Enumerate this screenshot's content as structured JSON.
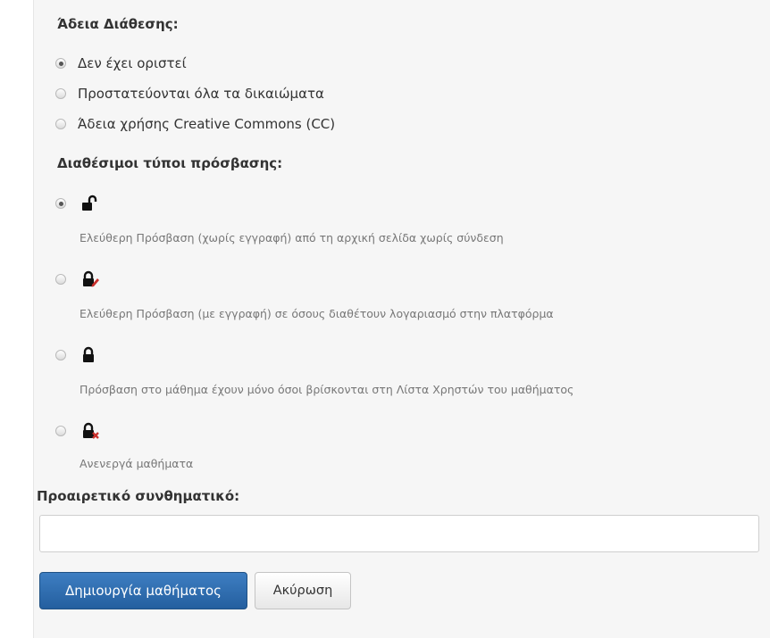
{
  "license": {
    "title": "Άδεια Διάθεσης:",
    "options": [
      {
        "label": "Δεν έχει οριστεί",
        "checked": true
      },
      {
        "label": "Προστατεύονται όλα τα δικαιώματα",
        "checked": false
      },
      {
        "label": "Άδεια χρήσης Creative Commons (CC)",
        "checked": false
      }
    ]
  },
  "access": {
    "title": "Διαθέσιμοι τύποι πρόσβασης:",
    "options": [
      {
        "icon": "unlocked-icon",
        "description": "Ελεύθερη Πρόσβαση (χωρίς εγγραφή) από τη αρχική σελίδα χωρίς σύνδεση",
        "checked": true
      },
      {
        "icon": "lock-pencil-icon",
        "description": "Ελεύθερη Πρόσβαση (με εγγραφή) σε όσους διαθέτουν λογαριασμό στην πλατφόρμα",
        "checked": false
      },
      {
        "icon": "lock-icon",
        "description": "Πρόσβαση στο μάθημα έχουν μόνο όσοι βρίσκονται στη Λίστα Χρηστών του μαθήματος",
        "checked": false
      },
      {
        "icon": "lock-disabled-icon",
        "description": "Ανενεργά μαθήματα",
        "checked": false
      }
    ]
  },
  "password": {
    "label": "Προαιρετικό συνθηματικό:",
    "value": "",
    "placeholder": ""
  },
  "buttons": {
    "create": "Δημιουργία μαθήματος",
    "cancel": "Ακύρωση"
  },
  "colors": {
    "primary": "#2d6cb0",
    "accent_red": "#d9534f"
  }
}
